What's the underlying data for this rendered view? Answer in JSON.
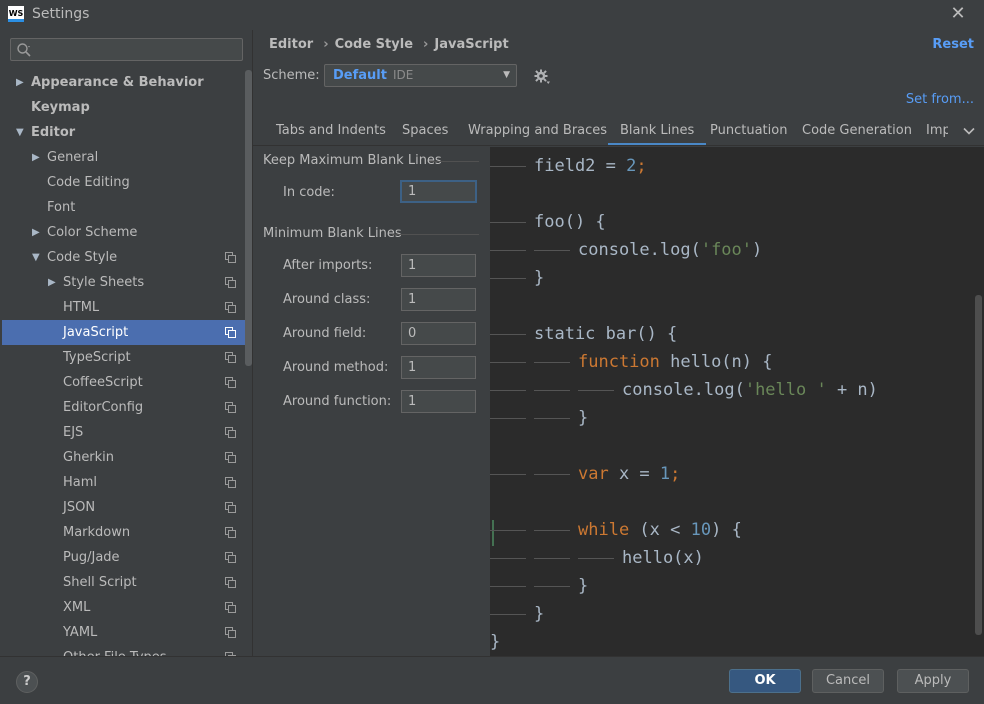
{
  "window": {
    "title": "Settings",
    "logo_text": "WS"
  },
  "search": {
    "placeholder": ""
  },
  "tree": [
    {
      "label": "Appearance & Behavior",
      "bold": true,
      "arrow": "▶",
      "indent": 0
    },
    {
      "label": "Keymap",
      "bold": true,
      "arrow": "",
      "indent": 0
    },
    {
      "label": "Editor",
      "bold": true,
      "arrow": "▼",
      "indent": 0
    },
    {
      "label": "General",
      "arrow": "▶",
      "indent": 1
    },
    {
      "label": "Code Editing",
      "arrow": "",
      "indent": 1
    },
    {
      "label": "Font",
      "arrow": "",
      "indent": 1
    },
    {
      "label": "Color Scheme",
      "arrow": "▶",
      "indent": 1
    },
    {
      "label": "Code Style",
      "arrow": "▼",
      "indent": 1,
      "copy": true
    },
    {
      "label": "Style Sheets",
      "arrow": "▶",
      "indent": 2,
      "copy": true
    },
    {
      "label": "HTML",
      "arrow": "",
      "indent": 2,
      "copy": true
    },
    {
      "label": "JavaScript",
      "arrow": "",
      "indent": 2,
      "copy": true,
      "selected": true
    },
    {
      "label": "TypeScript",
      "arrow": "",
      "indent": 2,
      "copy": true
    },
    {
      "label": "CoffeeScript",
      "arrow": "",
      "indent": 2,
      "copy": true
    },
    {
      "label": "EditorConfig",
      "arrow": "",
      "indent": 2,
      "copy": true
    },
    {
      "label": "EJS",
      "arrow": "",
      "indent": 2,
      "copy": true
    },
    {
      "label": "Gherkin",
      "arrow": "",
      "indent": 2,
      "copy": true
    },
    {
      "label": "Haml",
      "arrow": "",
      "indent": 2,
      "copy": true
    },
    {
      "label": "JSON",
      "arrow": "",
      "indent": 2,
      "copy": true
    },
    {
      "label": "Markdown",
      "arrow": "",
      "indent": 2,
      "copy": true
    },
    {
      "label": "Pug/Jade",
      "arrow": "",
      "indent": 2,
      "copy": true
    },
    {
      "label": "Shell Script",
      "arrow": "",
      "indent": 2,
      "copy": true
    },
    {
      "label": "XML",
      "arrow": "",
      "indent": 2,
      "copy": true
    },
    {
      "label": "YAML",
      "arrow": "",
      "indent": 2,
      "copy": true
    },
    {
      "label": "Other File Types",
      "arrow": "",
      "indent": 2,
      "copy": true
    }
  ],
  "breadcrumb": {
    "items": [
      "Editor",
      "Code Style",
      "JavaScript"
    ],
    "separator": "›"
  },
  "reset_label": "Reset",
  "scheme": {
    "label": "Scheme:",
    "name": "Default",
    "sub": "IDE"
  },
  "set_from_label": "Set from...",
  "tabs": [
    {
      "label": "Tabs and Indents"
    },
    {
      "label": "Spaces"
    },
    {
      "label": "Wrapping and Braces"
    },
    {
      "label": "Blank Lines",
      "active": true
    },
    {
      "label": "Punctuation"
    },
    {
      "label": "Code Generation"
    },
    {
      "label": "Imp"
    }
  ],
  "keep_max": {
    "title": "Keep Maximum Blank Lines",
    "fields": [
      {
        "label": "In code:",
        "value": "1"
      }
    ]
  },
  "minimum": {
    "title": "Minimum Blank Lines",
    "fields": [
      {
        "label": "After imports:",
        "value": "1"
      },
      {
        "label": "Around class:",
        "value": "1"
      },
      {
        "label": "Around field:",
        "value": "0"
      },
      {
        "label": "Around method:",
        "value": "1"
      },
      {
        "label": "Around function:",
        "value": "1"
      }
    ]
  },
  "code_lines": [
    {
      "indent": 1,
      "tokens": [
        [
          "field2 = ",
          ""
        ],
        [
          "2",
          "num"
        ],
        [
          ";",
          "kw"
        ]
      ]
    },
    {
      "indent": 0,
      "tokens": []
    },
    {
      "indent": 1,
      "tokens": [
        [
          "foo() {",
          ""
        ]
      ]
    },
    {
      "indent": 2,
      "tokens": [
        [
          "console.log(",
          ""
        ],
        [
          "'foo'",
          "str"
        ],
        [
          ")",
          ""
        ]
      ]
    },
    {
      "indent": 1,
      "tokens": [
        [
          "}",
          ""
        ]
      ]
    },
    {
      "indent": 0,
      "tokens": []
    },
    {
      "indent": 1,
      "tokens": [
        [
          "static bar() {",
          ""
        ]
      ]
    },
    {
      "indent": 2,
      "tokens": [
        [
          "function",
          "kw"
        ],
        [
          " hello(n) {",
          ""
        ]
      ]
    },
    {
      "indent": 3,
      "tokens": [
        [
          "console.log(",
          ""
        ],
        [
          "'hello '",
          "str"
        ],
        [
          " + n)",
          ""
        ]
      ]
    },
    {
      "indent": 2,
      "tokens": [
        [
          "}",
          ""
        ]
      ]
    },
    {
      "indent": 0,
      "tokens": []
    },
    {
      "indent": 2,
      "tokens": [
        [
          "var",
          "kw"
        ],
        [
          " x = ",
          ""
        ],
        [
          "1",
          "num"
        ],
        [
          ";",
          "kw"
        ]
      ]
    },
    {
      "indent": 0,
      "tokens": []
    },
    {
      "indent": 2,
      "tokens": [
        [
          "while",
          "kw"
        ],
        [
          " (x < ",
          ""
        ],
        [
          "10",
          "num"
        ],
        [
          ") {",
          ""
        ]
      ]
    },
    {
      "indent": 3,
      "tokens": [
        [
          "hello(x)",
          ""
        ]
      ]
    },
    {
      "indent": 2,
      "tokens": [
        [
          "}",
          ""
        ]
      ]
    },
    {
      "indent": 1,
      "tokens": [
        [
          "}",
          ""
        ]
      ]
    },
    {
      "indent": 0,
      "tokens": [
        [
          "}",
          ""
        ]
      ]
    }
  ],
  "buttons": {
    "help": "?",
    "ok": "OK",
    "cancel": "Cancel",
    "apply": "Apply"
  }
}
